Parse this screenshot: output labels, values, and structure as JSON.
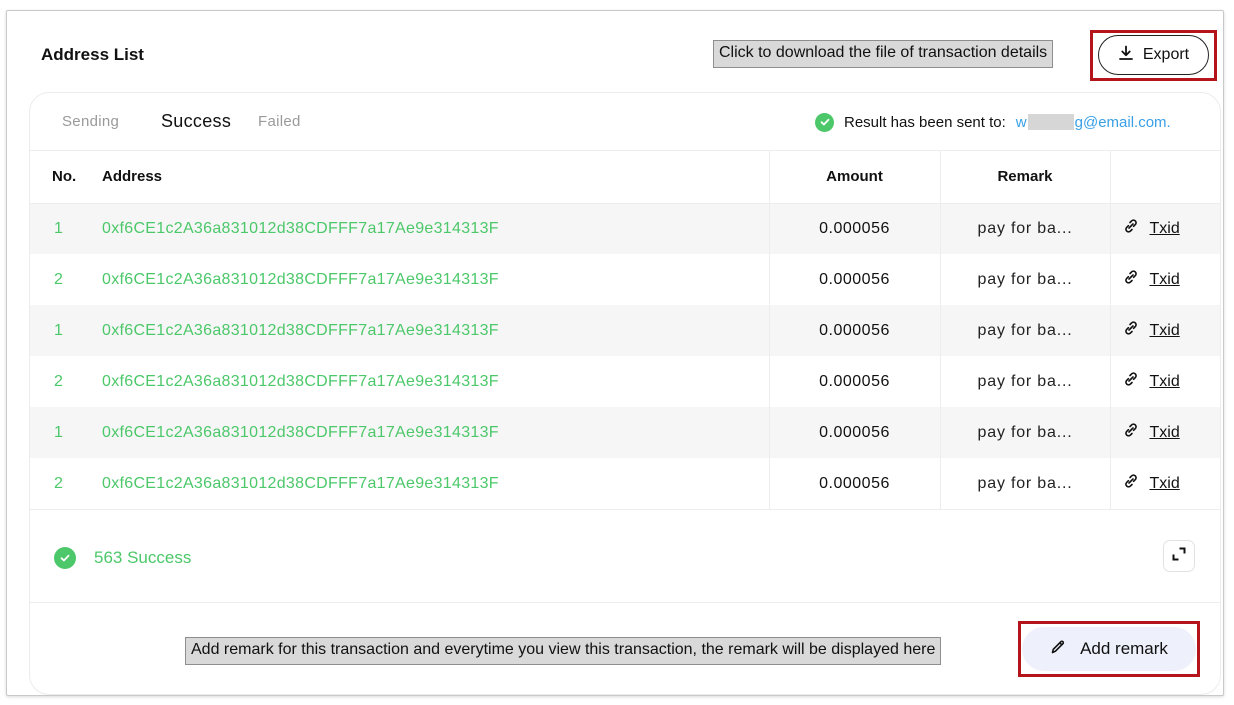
{
  "header": {
    "title": "Address List",
    "export_tooltip": "Click to download the file of transaction details",
    "export_label": "Export"
  },
  "tabs": [
    {
      "label": "Sending",
      "active": false
    },
    {
      "label": "Success",
      "active": true
    },
    {
      "label": "Failed",
      "active": false
    }
  ],
  "sent_note": {
    "text": "Result has been sent to:",
    "email_prefix": "w",
    "email_suffix": "g@email.com."
  },
  "table": {
    "columns": [
      "No.",
      "Address",
      "Amount",
      "Remark",
      ""
    ],
    "rows": [
      {
        "no": "1",
        "address": "0xf6CE1c2A36a831012d38CDFFF7a17Ae9e314313F",
        "amount": "0.000056",
        "remark": "pay for ba...",
        "link": "Txid"
      },
      {
        "no": "2",
        "address": "0xf6CE1c2A36a831012d38CDFFF7a17Ae9e314313F",
        "amount": "0.000056",
        "remark": "pay for ba...",
        "link": "Txid"
      },
      {
        "no": "1",
        "address": "0xf6CE1c2A36a831012d38CDFFF7a17Ae9e314313F",
        "amount": "0.000056",
        "remark": "pay for ba...",
        "link": "Txid"
      },
      {
        "no": "2",
        "address": "0xf6CE1c2A36a831012d38CDFFF7a17Ae9e314313F",
        "amount": "0.000056",
        "remark": "pay for ba...",
        "link": "Txid"
      },
      {
        "no": "1",
        "address": "0xf6CE1c2A36a831012d38CDFFF7a17Ae9e314313F",
        "amount": "0.000056",
        "remark": "pay for ba...",
        "link": "Txid"
      },
      {
        "no": "2",
        "address": "0xf6CE1c2A36a831012d38CDFFF7a17Ae9e314313F",
        "amount": "0.000056",
        "remark": "pay for ba...",
        "link": "Txid"
      }
    ]
  },
  "summary": {
    "text": "563 Success"
  },
  "remark": {
    "tooltip": "Add remark for this transaction and everytime you view this transaction, the remark will be displayed here",
    "button_label": "Add remark"
  },
  "colors": {
    "success_green": "#4cc86a",
    "email_blue": "#3aa0e6",
    "highlight_red": "#b3151b",
    "remark_button_bg": "#eef0fb"
  },
  "icons": {
    "export": "download-icon",
    "success": "check-circle-icon",
    "txid": "link-icon",
    "expand": "expand-icon",
    "remark": "pencil-icon"
  }
}
